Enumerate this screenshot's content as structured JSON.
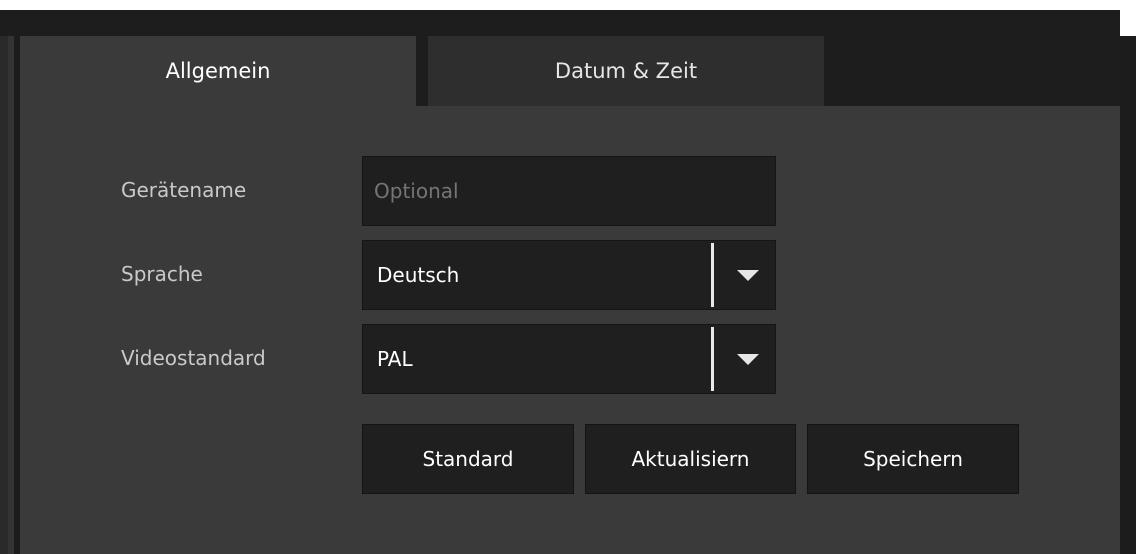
{
  "tabs": [
    {
      "label": "Allgemein",
      "active": true
    },
    {
      "label": "Datum & Zeit",
      "active": false
    }
  ],
  "form": {
    "device_name": {
      "label": "Gerätename",
      "value": "",
      "placeholder": "Optional"
    },
    "language": {
      "label": "Sprache",
      "value": "Deutsch"
    },
    "video_standard": {
      "label": "Videostandard",
      "value": "PAL"
    }
  },
  "buttons": {
    "default_label": "Standard",
    "refresh_label": "Aktualisiern",
    "save_label": "Speichern"
  },
  "colors": {
    "panel_background": "#3a3a3a",
    "field_background": "#1f1f1f",
    "text_primary": "#ffffff",
    "text_label": "#c9c9c9"
  }
}
